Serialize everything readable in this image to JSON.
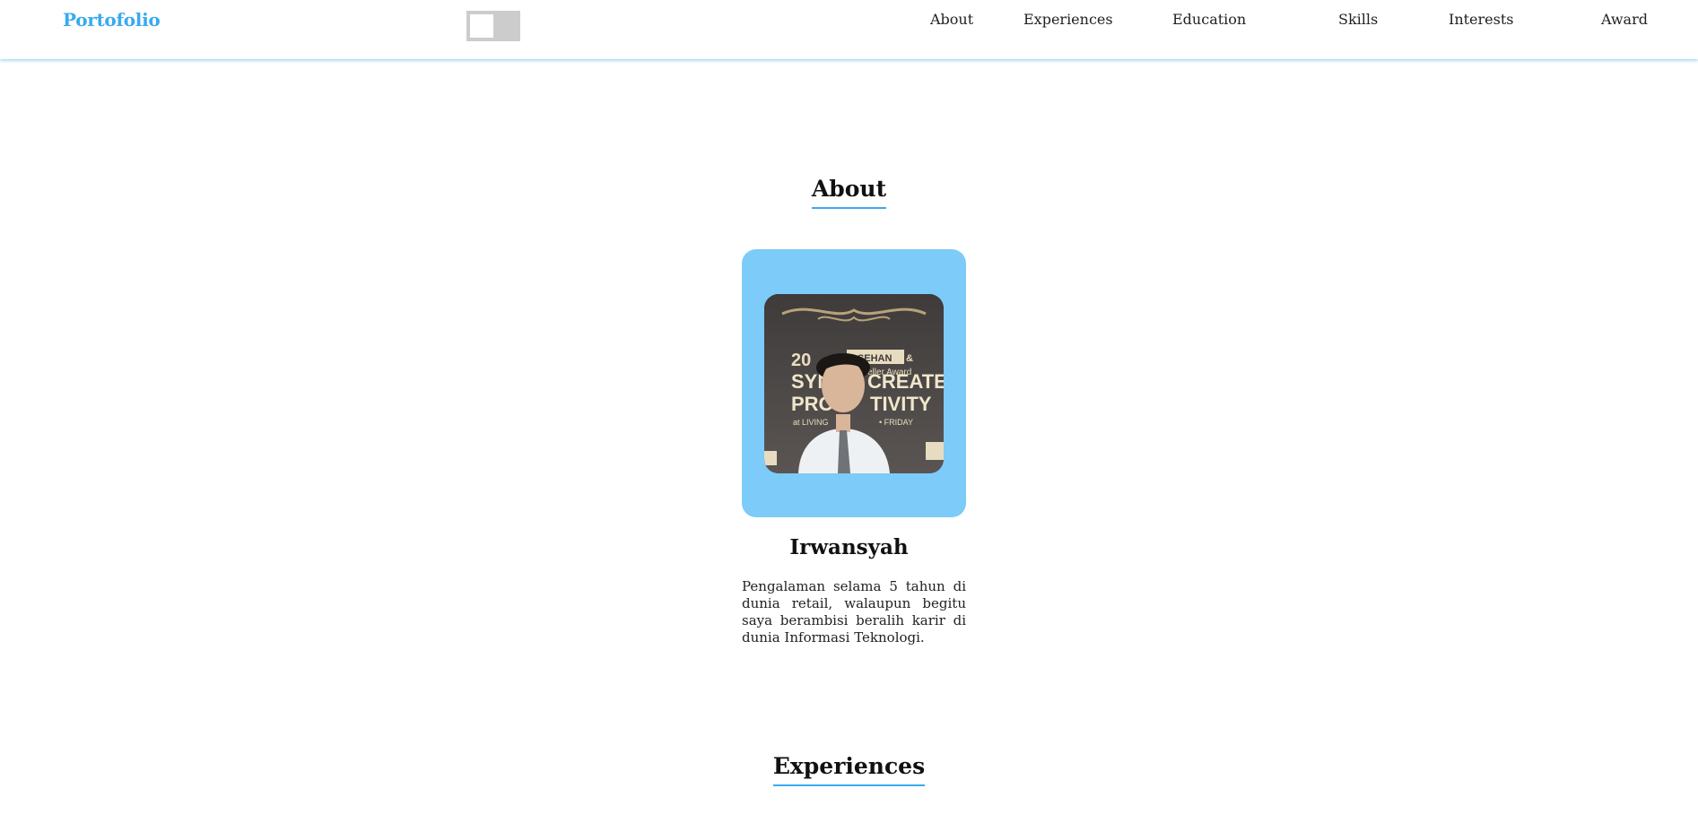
{
  "nav": {
    "brand": "Portofolio",
    "links": [
      {
        "label": "About"
      },
      {
        "label": "Experiences"
      },
      {
        "label": "Education"
      },
      {
        "label": "Skills"
      },
      {
        "label": "Interests"
      },
      {
        "label": "Award"
      }
    ],
    "theme_toggle": {
      "state": "off"
    }
  },
  "about": {
    "title": "About",
    "name": "Irwansyah",
    "bio": "Pengalaman selama 5 tahun di dunia retail, walaupun begitu saya berambisi beralih karir di dunia Informasi Teknologi.",
    "card_color": "#7ccbf9"
  },
  "experiences": {
    "title": "Experiences"
  },
  "colors": {
    "accent": "#3aaaf0",
    "text": "#111111"
  }
}
